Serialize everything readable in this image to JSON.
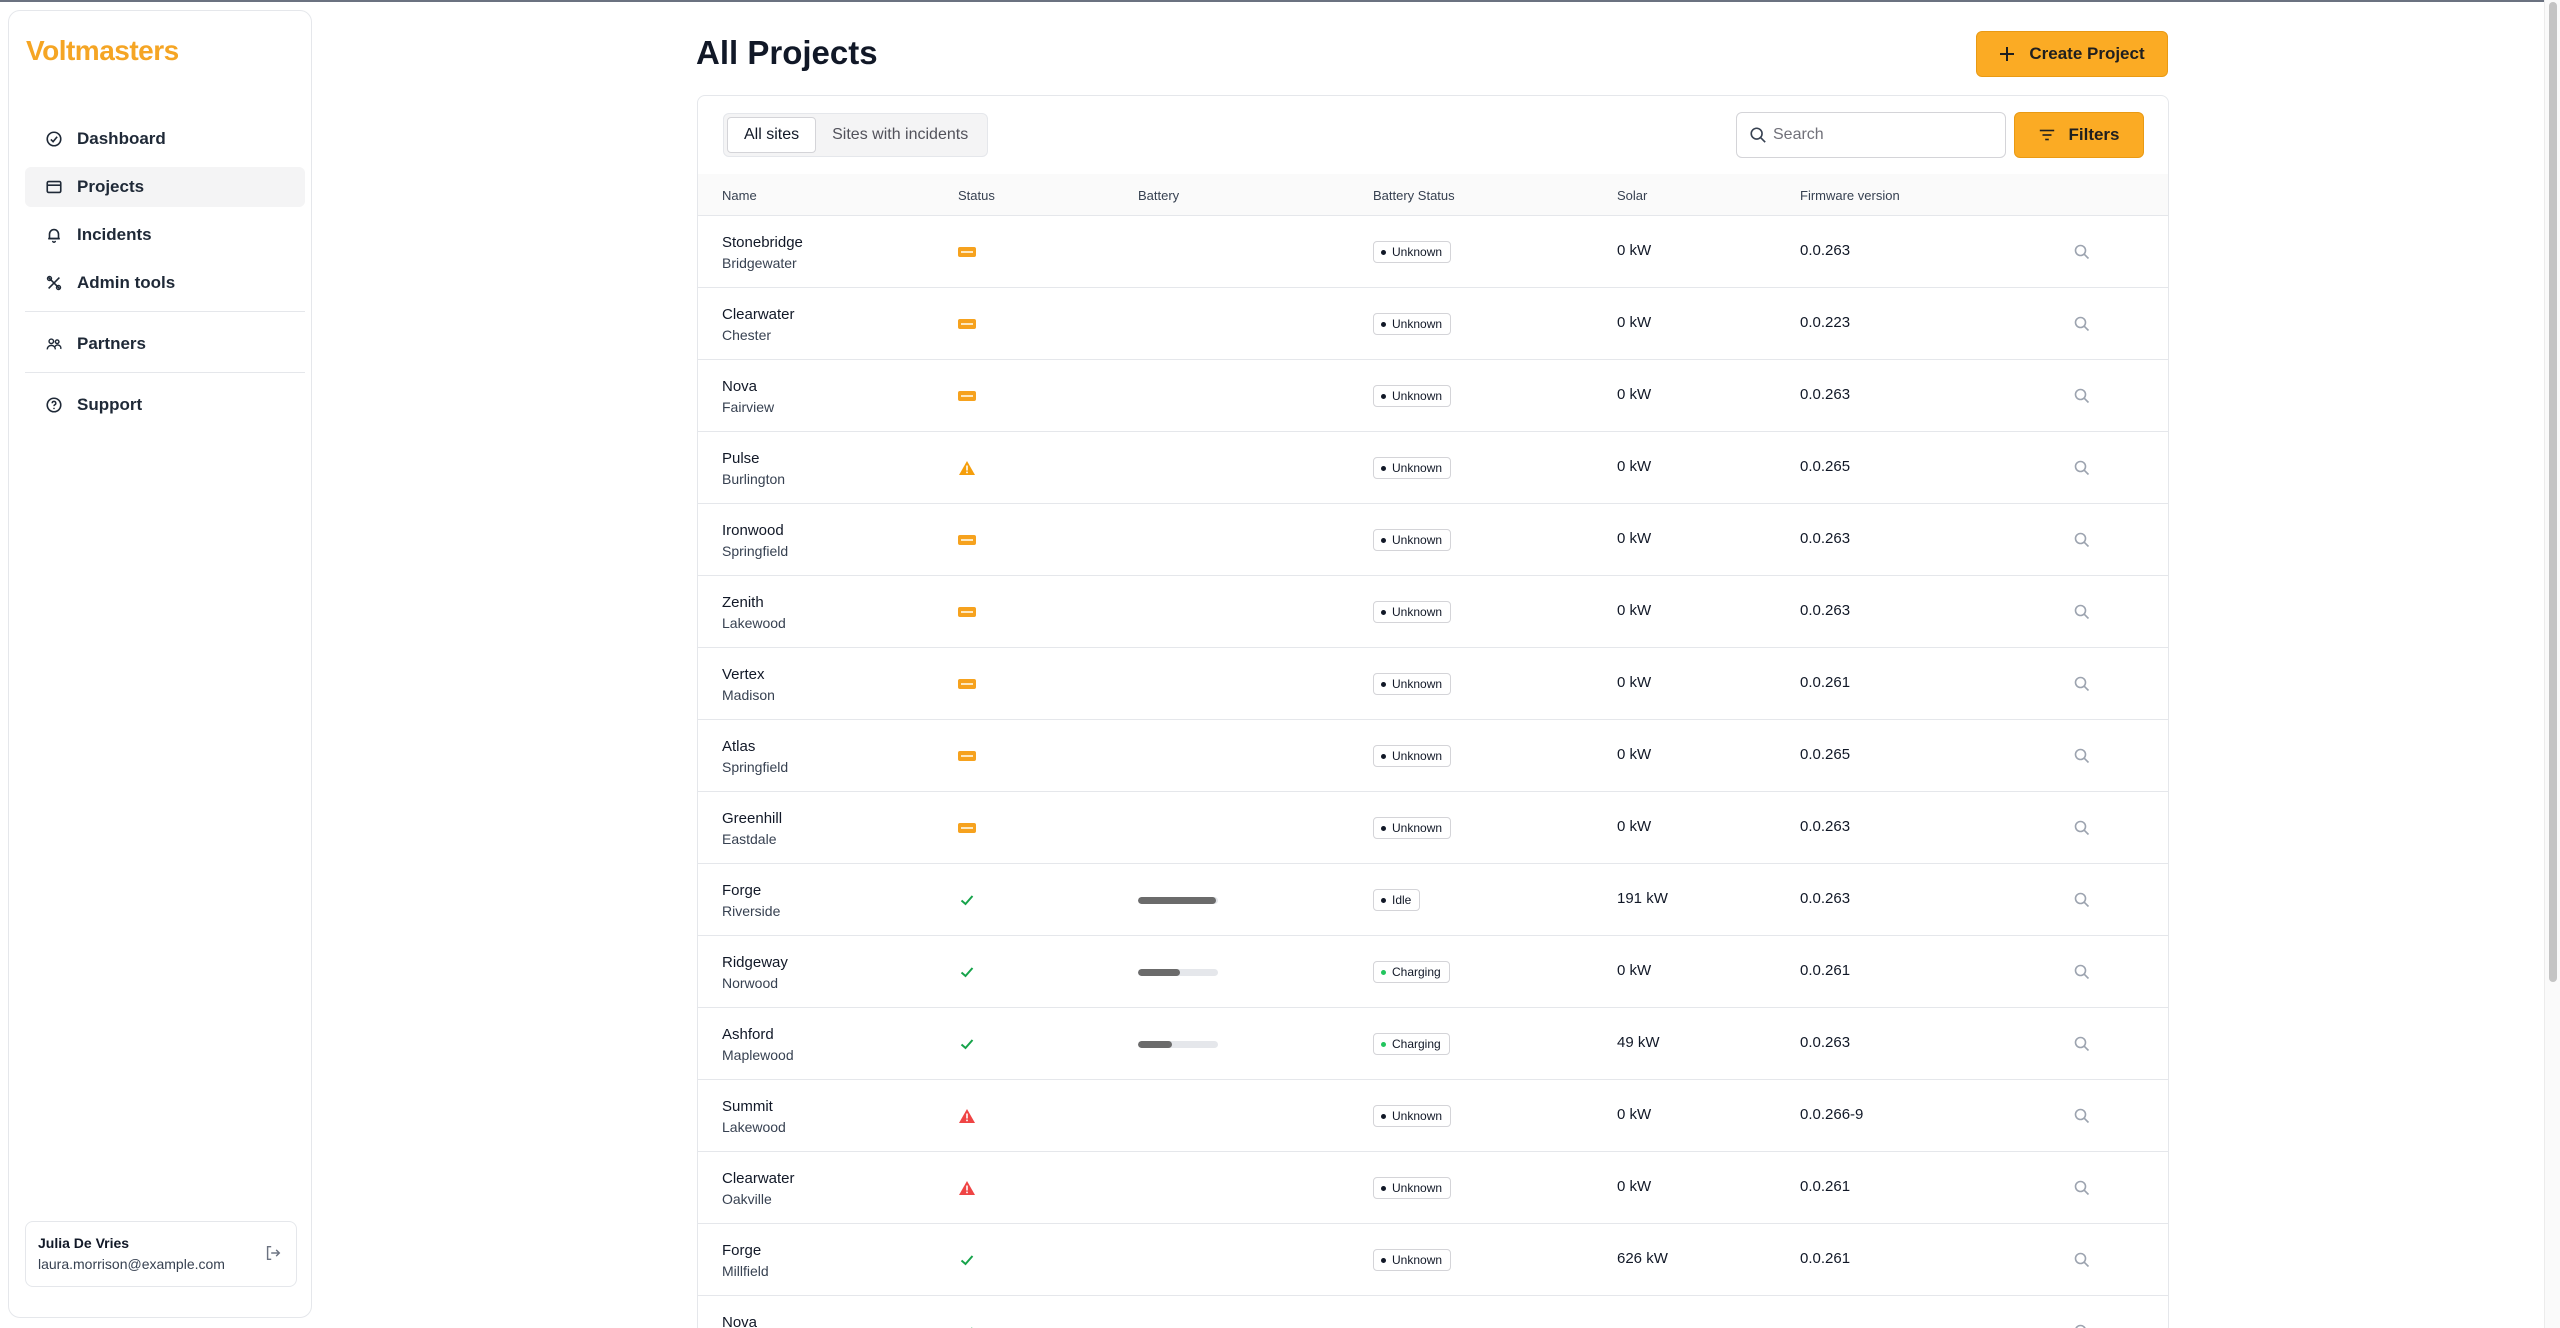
{
  "app": {
    "logo": "Voltmasters"
  },
  "sidebar": {
    "items": [
      {
        "label": "Dashboard",
        "icon": "dashboard-icon"
      },
      {
        "label": "Projects",
        "icon": "folder-icon",
        "active": true
      },
      {
        "label": "Incidents",
        "icon": "bell-icon"
      },
      {
        "label": "Admin tools",
        "icon": "tools-icon"
      },
      {
        "label": "Partners",
        "icon": "partners-icon"
      },
      {
        "label": "Support",
        "icon": "help-icon"
      }
    ],
    "user": {
      "name": "Julia De Vries",
      "email": "laura.morrison@example.com"
    }
  },
  "header": {
    "title": "All Projects",
    "create_label": "Create Project"
  },
  "toolbar": {
    "tabs": [
      "All sites",
      "Sites with incidents"
    ],
    "active_tab": "All sites",
    "search_placeholder": "Search",
    "filters_label": "Filters"
  },
  "table": {
    "columns": [
      "Name",
      "Status",
      "Battery",
      "Battery Status",
      "Solar",
      "Firmware version"
    ],
    "rows": [
      {
        "name": "Stonebridge",
        "site": "Bridgewater",
        "status": "new",
        "battery": null,
        "battery_status": "Unknown",
        "solar": "0 kW",
        "firmware": "0.0.263"
      },
      {
        "name": "Clearwater",
        "site": "Chester",
        "status": "new",
        "battery": null,
        "battery_status": "Unknown",
        "solar": "0 kW",
        "firmware": "0.0.223"
      },
      {
        "name": "Nova",
        "site": "Fairview",
        "status": "new",
        "battery": null,
        "battery_status": "Unknown",
        "solar": "0 kW",
        "firmware": "0.0.263"
      },
      {
        "name": "Pulse",
        "site": "Burlington",
        "status": "warning",
        "battery": null,
        "battery_status": "Unknown",
        "solar": "0 kW",
        "firmware": "0.0.265"
      },
      {
        "name": "Ironwood",
        "site": "Springfield",
        "status": "new",
        "battery": null,
        "battery_status": "Unknown",
        "solar": "0 kW",
        "firmware": "0.0.263"
      },
      {
        "name": "Zenith",
        "site": "Lakewood",
        "status": "new",
        "battery": null,
        "battery_status": "Unknown",
        "solar": "0 kW",
        "firmware": "0.0.263"
      },
      {
        "name": "Vertex",
        "site": "Madison",
        "status": "new",
        "battery": null,
        "battery_status": "Unknown",
        "solar": "0 kW",
        "firmware": "0.0.261"
      },
      {
        "name": "Atlas",
        "site": "Springfield",
        "status": "new",
        "battery": null,
        "battery_status": "Unknown",
        "solar": "0 kW",
        "firmware": "0.0.265"
      },
      {
        "name": "Greenhill",
        "site": "Eastdale",
        "status": "new",
        "battery": null,
        "battery_status": "Unknown",
        "solar": "0 kW",
        "firmware": "0.0.263"
      },
      {
        "name": "Forge",
        "site": "Riverside",
        "status": "ok",
        "battery": 0.97,
        "battery_status": "Idle",
        "solar": "191 kW",
        "firmware": "0.0.263"
      },
      {
        "name": "Ridgeway",
        "site": "Norwood",
        "status": "ok",
        "battery": 0.52,
        "battery_status": "Charging",
        "solar": "0 kW",
        "firmware": "0.0.261"
      },
      {
        "name": "Ashford",
        "site": "Maplewood",
        "status": "ok",
        "battery": 0.43,
        "battery_status": "Charging",
        "solar": "49 kW",
        "firmware": "0.0.263"
      },
      {
        "name": "Summit",
        "site": "Lakewood",
        "status": "error",
        "battery": null,
        "battery_status": "Unknown",
        "solar": "0 kW",
        "firmware": "0.0.266-9"
      },
      {
        "name": "Clearwater",
        "site": "Oakville",
        "status": "error",
        "battery": null,
        "battery_status": "Unknown",
        "solar": "0 kW",
        "firmware": "0.0.261"
      },
      {
        "name": "Forge",
        "site": "Millfield",
        "status": "ok",
        "battery": null,
        "battery_status": "Unknown",
        "solar": "626 kW",
        "firmware": "0.0.261"
      },
      {
        "name": "Nova",
        "site": "",
        "status": "ok",
        "battery": null,
        "battery_status": "",
        "solar": "",
        "firmware": ""
      }
    ]
  },
  "colors": {
    "accent": "#fbab24",
    "ok": "#16a34a",
    "warning": "#f59e0b",
    "error": "#ef4444",
    "charging_dot": "#22c55e"
  }
}
